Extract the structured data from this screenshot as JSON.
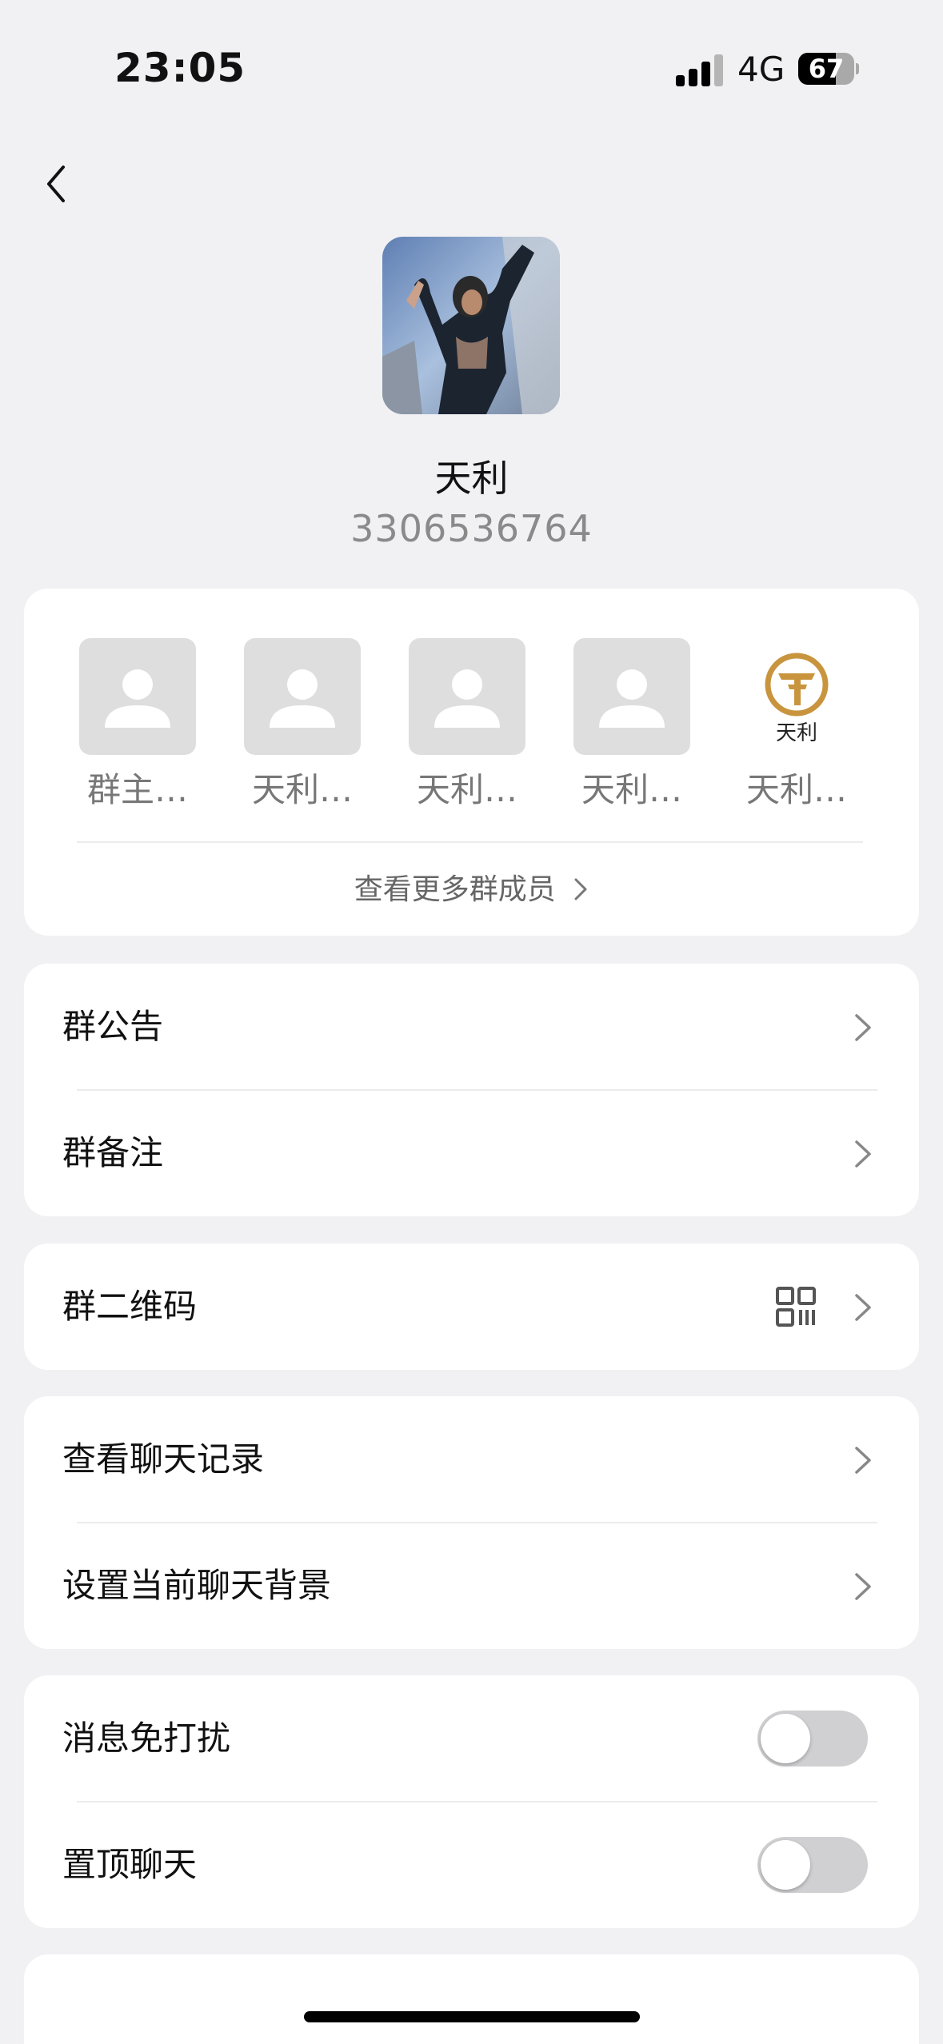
{
  "status_bar": {
    "time": "23:05",
    "network": "4G",
    "battery": "67",
    "battery_level": 0.67
  },
  "header": {
    "group_name": "天利",
    "group_id": "3306536764"
  },
  "members": {
    "items": [
      {
        "name": "群主…",
        "avatar": "default-avatar-icon"
      },
      {
        "name": "天利…",
        "avatar": "default-avatar-icon"
      },
      {
        "name": "天利…",
        "avatar": "default-avatar-icon"
      },
      {
        "name": "天利…",
        "avatar": "default-avatar-icon"
      },
      {
        "name": "天利…",
        "avatar": "tianli-logo",
        "logo_text": "天利"
      }
    ],
    "more_label": "查看更多群成员"
  },
  "settings": {
    "announcement": "群公告",
    "remark": "群备注",
    "qrcode": "群二维码",
    "chat_history": "查看聊天记录",
    "chat_background": "设置当前聊天背景",
    "do_not_disturb": {
      "label": "消息免打扰",
      "on": false
    },
    "pin_chat": {
      "label": "置顶聊天",
      "on": false
    }
  },
  "colors": {
    "background": "#f1f1f4",
    "card": "#ffffff",
    "logo_gold": "#c8953e"
  }
}
